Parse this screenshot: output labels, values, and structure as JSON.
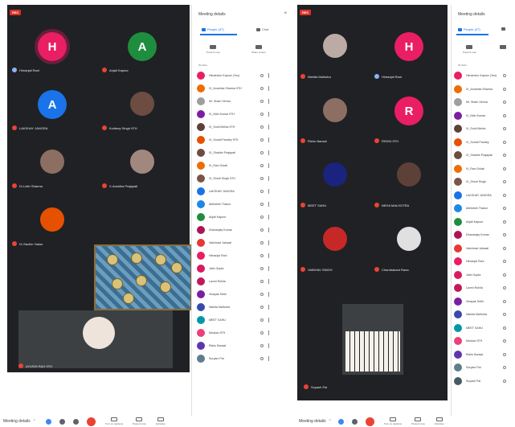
{
  "recording_badge": "REC",
  "panel": {
    "title": "Meeting details",
    "close_glyph": "×",
    "people_tab": "People (37)",
    "chat_tab": "Chat",
    "actions": [
      "Present now",
      "Share screen"
    ],
    "section_label": "IN CALL"
  },
  "colors": {
    "accent": "#1a73e8",
    "grid_bg": "#202124",
    "mic_off": "#ea4335",
    "end_call": "#ea4335"
  },
  "bottom_bar": {
    "meeting_label": "Meeting details",
    "tools": [
      "Turn on captions",
      "Present now",
      "Activities"
    ]
  },
  "left": {
    "tiles": [
      {
        "initial": "H",
        "color": "#e91e63",
        "ring": true,
        "name": "Himanjal Rani",
        "mic": "on"
      },
      {
        "initial": "A",
        "color": "#1e8e3e",
        "ring": false,
        "name": "Anjali Kapoor",
        "mic": "off"
      },
      {
        "initial": "A",
        "color": "#1a73e8",
        "ring": false,
        "name": "LAKSHAY JANGRA",
        "mic": "off"
      },
      {
        "initial": "",
        "color": "#6d4c41",
        "ring": false,
        "name": "Kuldeep Singh 9TH",
        "mic": "off"
      },
      {
        "initial": "",
        "color": "#8d6e63",
        "ring": false,
        "name": "IX-Lekh Sharma",
        "mic": "off"
      },
      {
        "initial": "",
        "color": "#a1887f",
        "ring": false,
        "name": "X-Anshika Prajapati",
        "mic": "off"
      },
      {
        "initial": "",
        "color": "#e65100",
        "ring": false,
        "name": "IX-Sachin Yadav",
        "mic": "off"
      }
    ],
    "self_name": "AYUSHI RAO 9TH",
    "participants": [
      {
        "name": "Himanshu Kapoor (You)",
        "color": "#e91e63"
      },
      {
        "name": "IX_Anushka Sharma 9TH",
        "color": "#ef6c00"
      },
      {
        "name": "Mr. Sham Verma",
        "color": "#9e9e9e"
      },
      {
        "name": "IX_Nitin Kumar 9TH",
        "color": "#7b1fa2"
      },
      {
        "name": "IX_Sunil Mehta 9TH",
        "color": "#5d4037"
      },
      {
        "name": "IX_Sonali Pandey 9TH",
        "color": "#e65100"
      },
      {
        "name": "IX_Shabbir Prajapati",
        "color": "#6d4c41"
      },
      {
        "name": "IX_Ravi Gulati",
        "color": "#ef6c00"
      },
      {
        "name": "IX_Shruti Singh 9TH",
        "color": "#795548"
      },
      {
        "name": "LAKSHAY JANGRA",
        "color": "#1a73e8"
      },
      {
        "name": "Abhishek Thakur",
        "color": "#1e88e5"
      },
      {
        "name": "Anjali Kapoor",
        "color": "#1e8e3e"
      },
      {
        "name": "Dhananjay Kumar",
        "color": "#ad1457"
      },
      {
        "name": "Vaishnavi Jaiswal",
        "color": "#e53935"
      },
      {
        "name": "Himanjal Rani",
        "color": "#e91e63"
      },
      {
        "name": "Jatin Gupta",
        "color": "#d81b60"
      },
      {
        "name": "Laxmi Rohila",
        "color": "#c2185b"
      },
      {
        "name": "Vinayak Sethi",
        "color": "#7b1fa2"
      },
      {
        "name": "Nishita Malhotra",
        "color": "#3949ab"
      },
      {
        "name": "MEET SAHU",
        "color": "#0097a7"
      },
      {
        "name": "Muskan 9TH",
        "color": "#ec407a"
      },
      {
        "name": "Rishu Bansal",
        "color": "#5e35b1"
      },
      {
        "name": "Suryam Pal",
        "color": "#607d8b"
      }
    ]
  },
  "right": {
    "tiles": [
      {
        "initial": "",
        "color": "#bcaaa4",
        "ring": false,
        "name": "Nishita Malhotra",
        "mic": "off"
      },
      {
        "initial": "H",
        "color": "#e91e63",
        "ring": false,
        "name": "Himanjal Rani",
        "mic": "on"
      },
      {
        "initial": "",
        "color": "#8d6e63",
        "ring": false,
        "name": "Rishu Bansal",
        "mic": "off"
      },
      {
        "initial": "R",
        "color": "#e91e63",
        "ring": false,
        "name": "RISHU 9TH",
        "mic": "off"
      },
      {
        "initial": "",
        "color": "#1a237e",
        "ring": false,
        "name": "MEET SAHU",
        "mic": "off"
      },
      {
        "initial": "",
        "color": "#5d4037",
        "ring": false,
        "name": "NEHA MALHOTRA",
        "mic": "off"
      },
      {
        "initial": "",
        "color": "#c62828",
        "ring": false,
        "name": "VAIBHAV SINGH",
        "mic": "off"
      },
      {
        "initial": "",
        "color": "#e0e0e0",
        "ring": false,
        "name": "Chandrakant Rana",
        "mic": "off"
      }
    ],
    "self_name": "Suyash Pal",
    "participants": [
      {
        "name": "Himanshu Kapoor (You)",
        "color": "#e91e63"
      },
      {
        "name": "IX_Anushka Sharma",
        "color": "#ef6c00"
      },
      {
        "name": "Mr. Sham Verma",
        "color": "#9e9e9e"
      },
      {
        "name": "IX_Nitin Kumar",
        "color": "#7b1fa2"
      },
      {
        "name": "IX_Sunil Mehta",
        "color": "#5d4037"
      },
      {
        "name": "IX_Sonali Pandey",
        "color": "#e65100"
      },
      {
        "name": "IX_Shabbir Prajapati",
        "color": "#6d4c41"
      },
      {
        "name": "IX_Ravi Gulati",
        "color": "#ef6c00"
      },
      {
        "name": "IX_Shruti Singh",
        "color": "#795548"
      },
      {
        "name": "LAKSHAY JANGRA",
        "color": "#1a73e8"
      },
      {
        "name": "Abhishek Thakur",
        "color": "#1e88e5"
      },
      {
        "name": "Anjali Kapoor",
        "color": "#1e8e3e"
      },
      {
        "name": "Dhananjay Kumar",
        "color": "#ad1457"
      },
      {
        "name": "Vaishnavi Jaiswal",
        "color": "#e53935"
      },
      {
        "name": "Himanjal Rani",
        "color": "#e91e63"
      },
      {
        "name": "Jatin Gupta",
        "color": "#d81b60"
      },
      {
        "name": "Laxmi Rohila",
        "color": "#c2185b"
      },
      {
        "name": "Vinayak Sethi",
        "color": "#7b1fa2"
      },
      {
        "name": "Nishita Malhotra",
        "color": "#3949ab"
      },
      {
        "name": "MEET SAHU",
        "color": "#0097a7"
      },
      {
        "name": "Muskan 9TH",
        "color": "#ec407a"
      },
      {
        "name": "Rishu Bansal",
        "color": "#5e35b1"
      },
      {
        "name": "Suryam Pal",
        "color": "#607d8b"
      },
      {
        "name": "Suyash Pal",
        "color": "#455a64"
      }
    ]
  }
}
